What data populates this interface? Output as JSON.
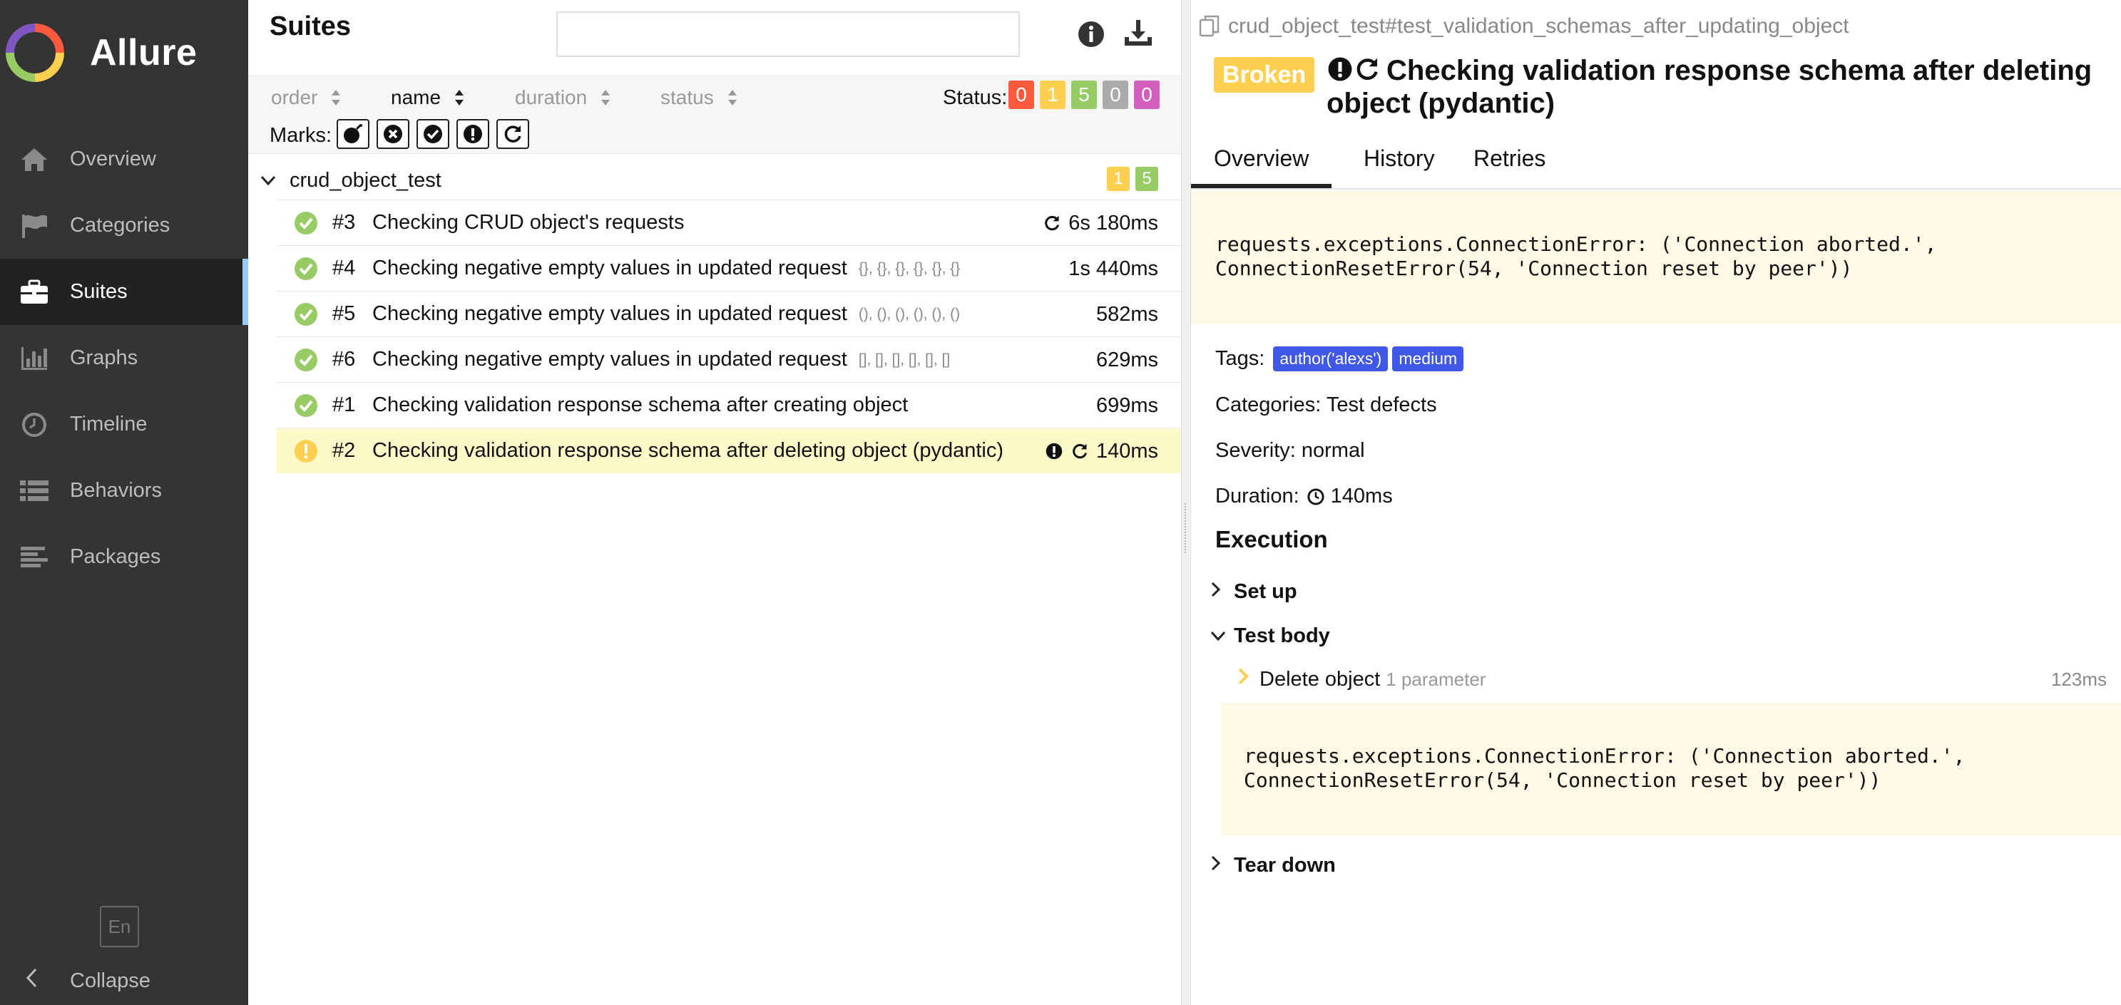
{
  "app": {
    "brand": "Allure",
    "nav": [
      {
        "label": "Overview",
        "icon": "home-icon"
      },
      {
        "label": "Categories",
        "icon": "flag-icon"
      },
      {
        "label": "Suites",
        "icon": "briefcase-icon"
      },
      {
        "label": "Graphs",
        "icon": "bar-chart-icon"
      },
      {
        "label": "Timeline",
        "icon": "clock-icon"
      },
      {
        "label": "Behaviors",
        "icon": "list-icon"
      },
      {
        "label": "Packages",
        "icon": "align-left-icon"
      }
    ],
    "active_nav": "Suites",
    "language": "En",
    "collapse_label": "Collapse"
  },
  "suites": {
    "title": "Suites",
    "search": {
      "value": "",
      "placeholder": ""
    },
    "sort": {
      "order": "order",
      "name": "name",
      "duration": "duration",
      "status": "status",
      "active": "name"
    },
    "status_label": "Status:",
    "status_counts": [
      {
        "value": "0",
        "status": "failed",
        "color": "#fd5a3e"
      },
      {
        "value": "1",
        "status": "broken",
        "color": "#ffd050"
      },
      {
        "value": "5",
        "status": "passed",
        "color": "#97cc64"
      },
      {
        "value": "0",
        "status": "skipped",
        "color": "#aaaaaa"
      },
      {
        "value": "0",
        "status": "unknown",
        "color": "#d35ebe"
      }
    ],
    "marks_label": "Marks:",
    "marks": [
      "bomb-icon",
      "times-circle-icon",
      "check-circle-icon",
      "exclamation-circle-icon",
      "refresh-icon"
    ],
    "group": {
      "name": "crud_object_test",
      "counts": [
        {
          "value": "1",
          "color": "#ffd050"
        },
        {
          "value": "5",
          "color": "#97cc64"
        }
      ]
    },
    "rows": [
      {
        "num": "#3",
        "name": "Checking CRUD object's requests",
        "params": "",
        "duration": "6s 180ms",
        "status": "passed",
        "retries": true,
        "flaky": false
      },
      {
        "num": "#4",
        "name": "Checking negative empty values in updated request",
        "params": "{}, {}, {}, {}, {}, {}",
        "duration": "1s 440ms",
        "status": "passed",
        "retries": false,
        "flaky": false
      },
      {
        "num": "#5",
        "name": "Checking negative empty values in updated request",
        "params": "(), (), (), (), (), ()",
        "duration": "582ms",
        "status": "passed",
        "retries": false,
        "flaky": false
      },
      {
        "num": "#6",
        "name": "Checking negative empty values in updated request",
        "params": "[], [], [], [], [], []",
        "duration": "629ms",
        "status": "passed",
        "retries": false,
        "flaky": false
      },
      {
        "num": "#1",
        "name": "Checking validation response schema after creating object",
        "params": "",
        "duration": "699ms",
        "status": "passed",
        "retries": false,
        "flaky": false
      },
      {
        "num": "#2",
        "name": "Checking validation response schema after deleting object (pydantic)",
        "params": "",
        "duration": "140ms",
        "status": "broken",
        "retries": true,
        "flaky": true
      }
    ]
  },
  "detail": {
    "breadcrumb": "crud_object_test#test_validation_schemas_after_updating_object",
    "status_badge": "Broken",
    "title": "Checking validation response schema after deleting object (pydantic)",
    "tabs": [
      "Overview",
      "History",
      "Retries"
    ],
    "active_tab": "Overview",
    "error": "requests.exceptions.ConnectionError: ('Connection aborted.',\nConnectionResetError(54, 'Connection reset by peer'))",
    "tags_label": "Tags:",
    "tags": [
      "author('alexs')",
      "medium"
    ],
    "categories": "Categories: Test defects",
    "severity": "Severity: normal",
    "duration_label": "Duration:",
    "duration": "140ms",
    "execution_title": "Execution",
    "setup_label": "Set up",
    "body_label": "Test body",
    "step": {
      "name": "Delete object",
      "params": "1 parameter",
      "duration": "123ms"
    },
    "step_error": "requests.exceptions.ConnectionError: ('Connection aborted.',\nConnectionResetError(54, 'Connection reset by peer'))",
    "teardown_label": "Tear down"
  }
}
